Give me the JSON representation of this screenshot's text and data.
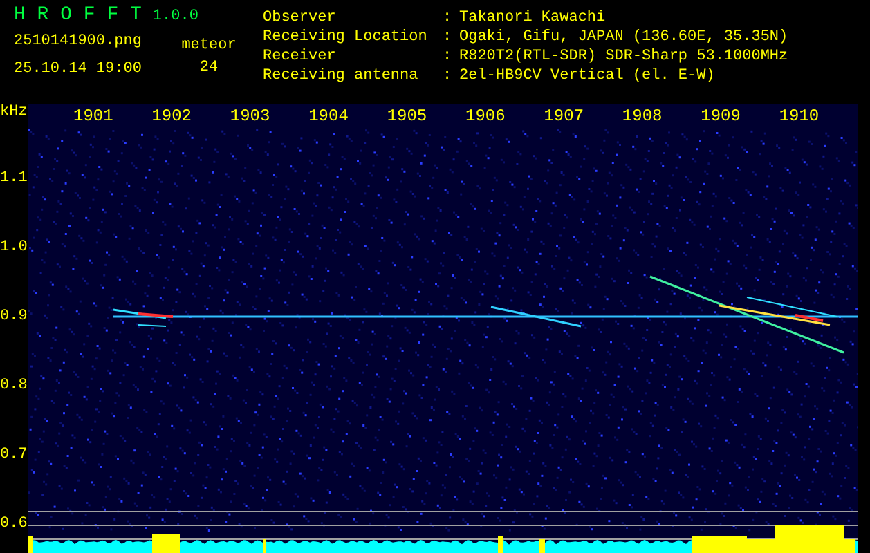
{
  "app": {
    "name": "H R O F F T",
    "version": "1.0.0"
  },
  "file": {
    "name": "2510141900.png",
    "datetime": "25.10.14 19:00"
  },
  "meteor": {
    "label": "meteor",
    "count": "24"
  },
  "info": [
    {
      "label": "Observer",
      "separator": ":",
      "value": "Takanori Kawachi"
    },
    {
      "label": "Receiving Location",
      "separator": ":",
      "value": "Ogaki, Gifu, JAPAN (136.60E, 35.35N)"
    },
    {
      "label": "Receiver",
      "separator": ":",
      "value": "R820T2(RTL-SDR) SDR-Sharp 53.1000MHz"
    },
    {
      "label": "Receiving antenna",
      "separator": ":",
      "value": "2el-HB9CV Vertical (el. E-W)"
    }
  ],
  "y_axis": {
    "unit": "kHz",
    "labels": [
      "1.1",
      "1.0",
      "0.9",
      "0.8",
      "0.7",
      "0.6"
    ]
  },
  "x_axis": {
    "labels": [
      "1901",
      "1902",
      "1903",
      "1904",
      "1905",
      "1906",
      "1907",
      "1908",
      "1909",
      "1910"
    ]
  }
}
